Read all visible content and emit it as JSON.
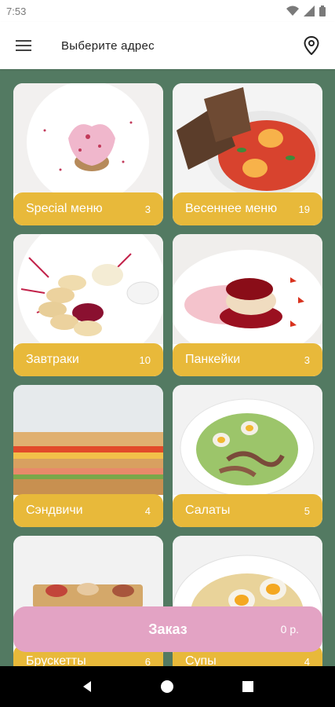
{
  "status": {
    "time": "7:53"
  },
  "appbar": {
    "title": "Выберите адрес"
  },
  "categories": [
    {
      "name": "Special меню",
      "count": "3"
    },
    {
      "name": "Весеннее меню",
      "count": "19"
    },
    {
      "name": "Завтраки",
      "count": "10"
    },
    {
      "name": "Панкейки",
      "count": "3"
    },
    {
      "name": "Сэндвичи",
      "count": "4"
    },
    {
      "name": "Салаты",
      "count": "5"
    },
    {
      "name": "Брускетты",
      "count": "6"
    },
    {
      "name": "Супы",
      "count": "4"
    }
  ],
  "order": {
    "label": "Заказ",
    "price": "0 р."
  },
  "colors": {
    "background": "#537a62",
    "label_bar": "#e8b93a",
    "order_button": "#e3a3c4"
  }
}
